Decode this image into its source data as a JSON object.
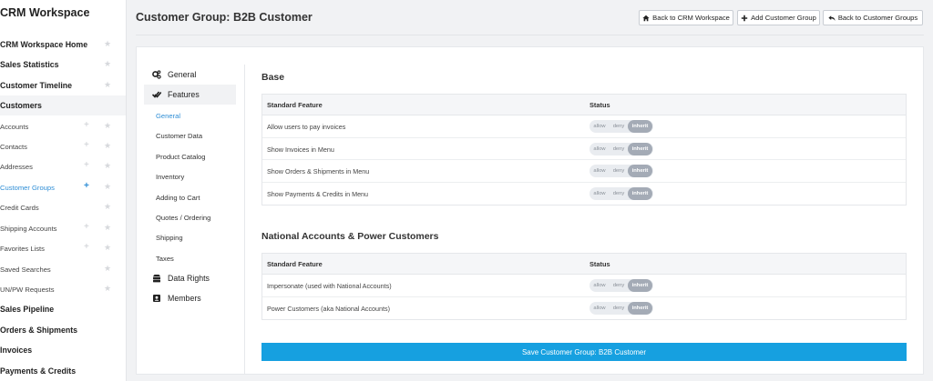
{
  "sidebar": {
    "title": "CRM Workspace",
    "items": [
      {
        "label": "CRM Workspace Home",
        "bold": true
      },
      {
        "label": "Sales Statistics",
        "bold": true
      },
      {
        "label": "Customer Timeline",
        "bold": true
      },
      {
        "label": "Customers",
        "bold": true,
        "section": true
      },
      {
        "label": "Accounts",
        "plus": true
      },
      {
        "label": "Contacts",
        "plus": true
      },
      {
        "label": "Addresses",
        "plus": true
      },
      {
        "label": "Customer Groups",
        "plus": true,
        "active": true
      },
      {
        "label": "Credit Cards"
      },
      {
        "label": "Shipping Accounts",
        "plus": true
      },
      {
        "label": "Favorites Lists",
        "plus": true
      },
      {
        "label": "Saved Searches"
      },
      {
        "label": "UN/PW Requests"
      },
      {
        "label": "Sales Pipeline",
        "bold": true
      },
      {
        "label": "Orders & Shipments",
        "bold": true
      },
      {
        "label": "Invoices",
        "bold": true
      },
      {
        "label": "Payments & Credits",
        "bold": true
      }
    ]
  },
  "header": {
    "title": "Customer Group: B2B Customer",
    "buttons": {
      "back_crm": "Back to CRM Workspace",
      "add_group": "Add Customer Group",
      "back_groups": "Back to Customer Groups"
    }
  },
  "nav": {
    "general": "General",
    "features": "Features",
    "sub": [
      "General",
      "Customer Data",
      "Product Catalog",
      "Inventory",
      "Adding to Cart",
      "Quotes / Ordering",
      "Shipping",
      "Taxes"
    ],
    "data_rights": "Data Rights",
    "members": "Members"
  },
  "sections": [
    {
      "title": "Base",
      "col_feature": "Standard Feature",
      "col_status": "Status",
      "rows": [
        {
          "name": "Allow users to pay invoices",
          "status": "inherit"
        },
        {
          "name": "Show Invoices in Menu",
          "status": "inherit"
        },
        {
          "name": "Show Orders & Shipments in Menu",
          "status": "inherit"
        },
        {
          "name": "Show Payments & Credits in Menu",
          "status": "inherit"
        }
      ]
    },
    {
      "title": "National Accounts & Power Customers",
      "col_feature": "Standard Feature",
      "col_status": "Status",
      "rows": [
        {
          "name": "Impersonate (used with National Accounts)",
          "status": "inherit"
        },
        {
          "name": "Power Customers (aka National Accounts)",
          "status": "inherit"
        }
      ]
    }
  ],
  "toggle_labels": {
    "allow": "allow",
    "deny": "deny",
    "inherit": "inherit"
  },
  "save_label": "Save Customer Group: B2B Customer",
  "colors": {
    "accent": "#16a0e0",
    "link": "#2f8ed6",
    "inherit_pill": "#a4abb6"
  }
}
